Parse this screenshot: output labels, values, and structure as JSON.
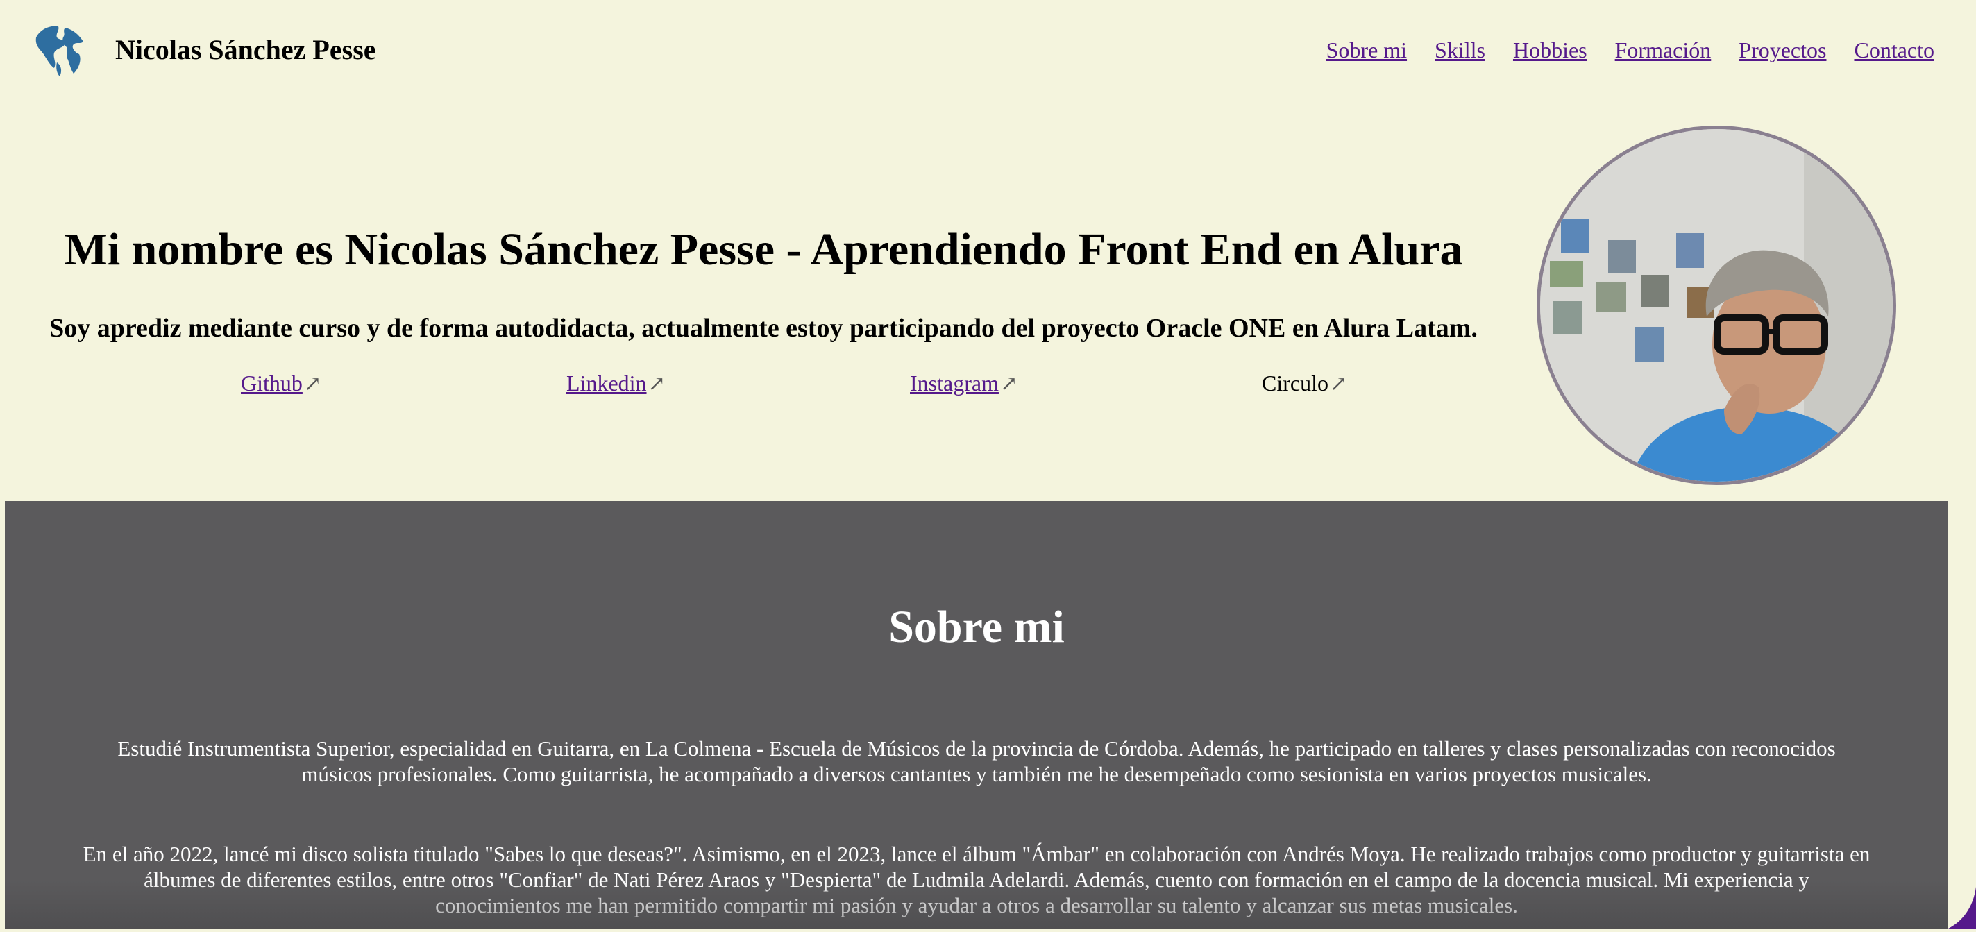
{
  "header": {
    "brand": "Nicolas Sánchez Pesse",
    "logo_icon": "globe-icon",
    "nav": [
      {
        "label": "Sobre mi"
      },
      {
        "label": "Skills"
      },
      {
        "label": "Hobbies"
      },
      {
        "label": "Formación"
      },
      {
        "label": "Proyectos"
      },
      {
        "label": "Contacto"
      }
    ]
  },
  "hero": {
    "title": "Mi nombre es Nicolas Sánchez Pesse - Aprendiendo Front End en Alura",
    "subtitle": "Soy aprediz mediante curso y de forma autodidacta, actualmente estoy participando del proyecto Oracle ONE en Alura Latam.",
    "links": [
      {
        "label": "Github",
        "arrow": "↗"
      },
      {
        "label": "Linkedin",
        "arrow": "↗"
      },
      {
        "label": "Instagram",
        "arrow": "↗"
      },
      {
        "label": "Circulo",
        "arrow": "↗"
      }
    ]
  },
  "about": {
    "title": "Sobre mi",
    "paragraphs": [
      "Estudié Instrumentista Superior, especialidad en Guitarra, en La Colmena - Escuela de Músicos de la provincia de Córdoba. Además, he participado en talleres y clases personalizadas con reconocidos músicos profesionales. Como guitarrista, he acompañado a diversos cantantes y también me he desempeñado como sesionista en varios proyectos musicales.",
      "En el año 2022, lancé mi disco solista titulado \"Sabes lo que deseas?\". Asimismo, en el 2023, lance el álbum \"Ámbar\" en colaboración con Andrés Moya. He realizado trabajos como productor y guitarrista en álbumes de diferentes estilos, entre otros \"Confiar\" de Nati Pérez Araos y \"Despierta\" de Ludmila Adelardi. Además, cuento con formación en el campo de la docencia musical. Mi experiencia y conocimientos me han permitido compartir mi pasión y ayudar a otros a desarrollar su talento y alcanzar sus metas musicales."
    ]
  },
  "colors": {
    "page_background": "#f4f4dd",
    "section_background": "#5b5a5c",
    "link": "#55198b",
    "globe": "#2e6ea0"
  }
}
